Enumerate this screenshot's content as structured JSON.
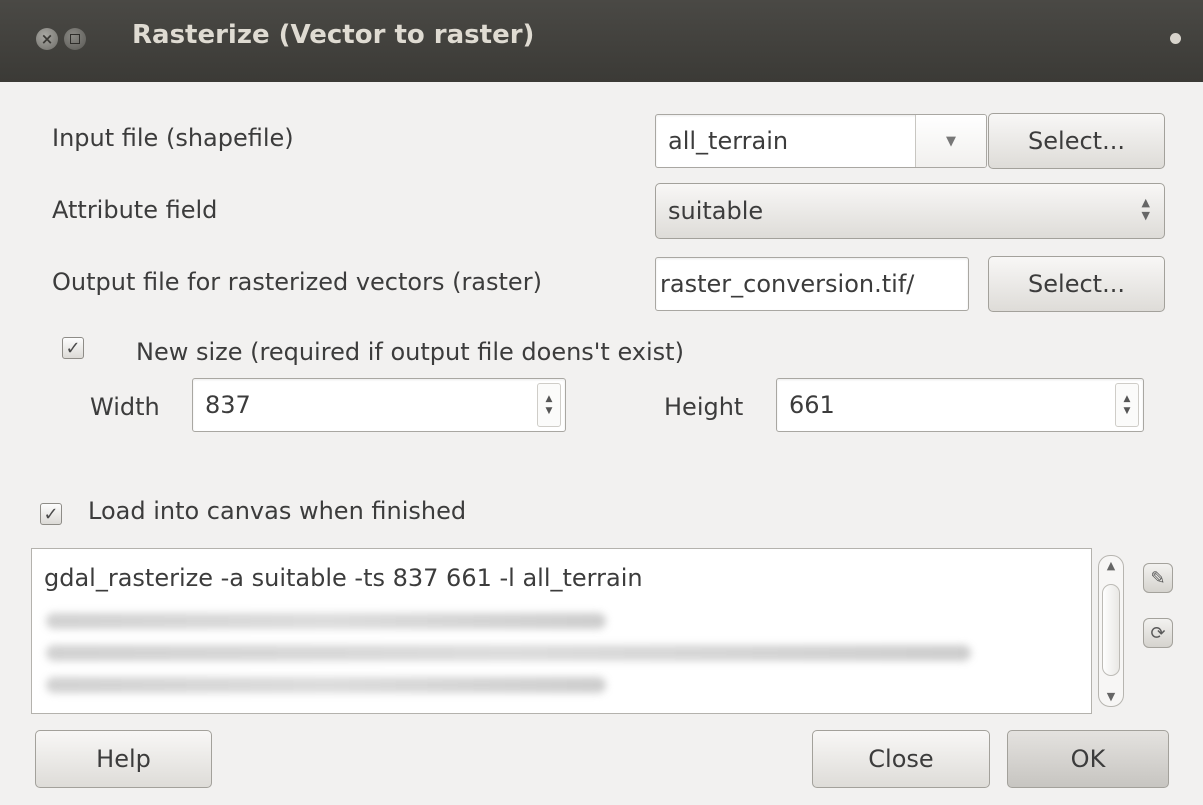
{
  "window": {
    "title": "Rasterize (Vector to raster)"
  },
  "form": {
    "input_label": "Input file (shapefile)",
    "input_value": "all_terrain",
    "input_select": "Select...",
    "attribute_label": "Attribute field",
    "attribute_value": "suitable",
    "output_label": "Output file for rasterized vectors (raster)",
    "output_value": "/raster_conversion.tif",
    "output_select": "Select...",
    "new_size_checked": true,
    "new_size_label": "New size (required if output file doens't exist)",
    "width_label": "Width",
    "width_value": "837",
    "height_label": "Height",
    "height_value": "661",
    "load_checked": true,
    "load_label": "Load into canvas when finished"
  },
  "command": {
    "text": "gdal_rasterize -a suitable -ts 837 661 -l all_terrain"
  },
  "buttons": {
    "help": "Help",
    "close": "Close",
    "ok": "OK"
  },
  "icons": {
    "edit": "pencil-icon",
    "reset": "reset-icon"
  }
}
